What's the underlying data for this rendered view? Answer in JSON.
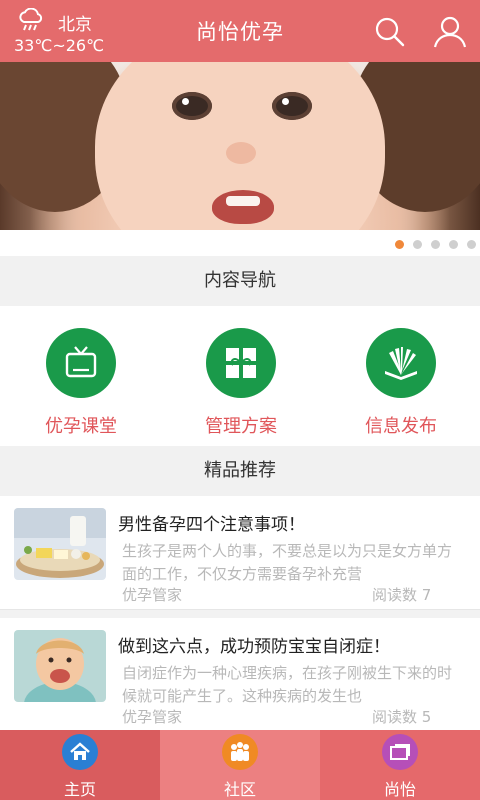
{
  "header": {
    "city": "北京",
    "temperature": "33℃~26℃",
    "title": "尚怡优孕",
    "weather_icon": "rain-cloud-icon",
    "search_icon": "search-icon",
    "user_icon": "user-icon"
  },
  "banner": {
    "slide_count": 5,
    "active_slide": 1,
    "active_dot_color": "#f0883a"
  },
  "content_nav": {
    "heading": "内容导航",
    "items": [
      {
        "label": "优孕课堂",
        "icon": "tv-icon"
      },
      {
        "label": "管理方案",
        "icon": "gift-icon"
      },
      {
        "label": "信息发布",
        "icon": "book-icon"
      }
    ]
  },
  "recommend": {
    "heading": "精品推荐",
    "articles": [
      {
        "title": "男性备孕四个注意事项！",
        "summary": "生孩子是两个人的事，不要总是以为只是女方单方面的工作，不仅女方需要备孕补充营",
        "source": "优孕管家",
        "reads": "阅读数 7"
      },
      {
        "title": "做到这六点，成功预防宝宝自闭症！",
        "summary": "自闭症作为一种心理疾病，在孩子刚被生下来的时候就可能产生了。这种疾病的发生也",
        "source": "优孕管家",
        "reads": "阅读数 5"
      }
    ]
  },
  "tabbar": {
    "items": [
      {
        "label": "主页",
        "icon": "home-icon",
        "color": "#2a7fd4"
      },
      {
        "label": "社区",
        "icon": "community-icon",
        "color": "#f08a24"
      },
      {
        "label": "尚怡",
        "icon": "gallery-icon",
        "color": "#b64fb8"
      }
    ]
  },
  "colors": {
    "brand": "#e46b6c",
    "nav_green": "#1a9a4a",
    "nav_label": "#e0565a"
  }
}
